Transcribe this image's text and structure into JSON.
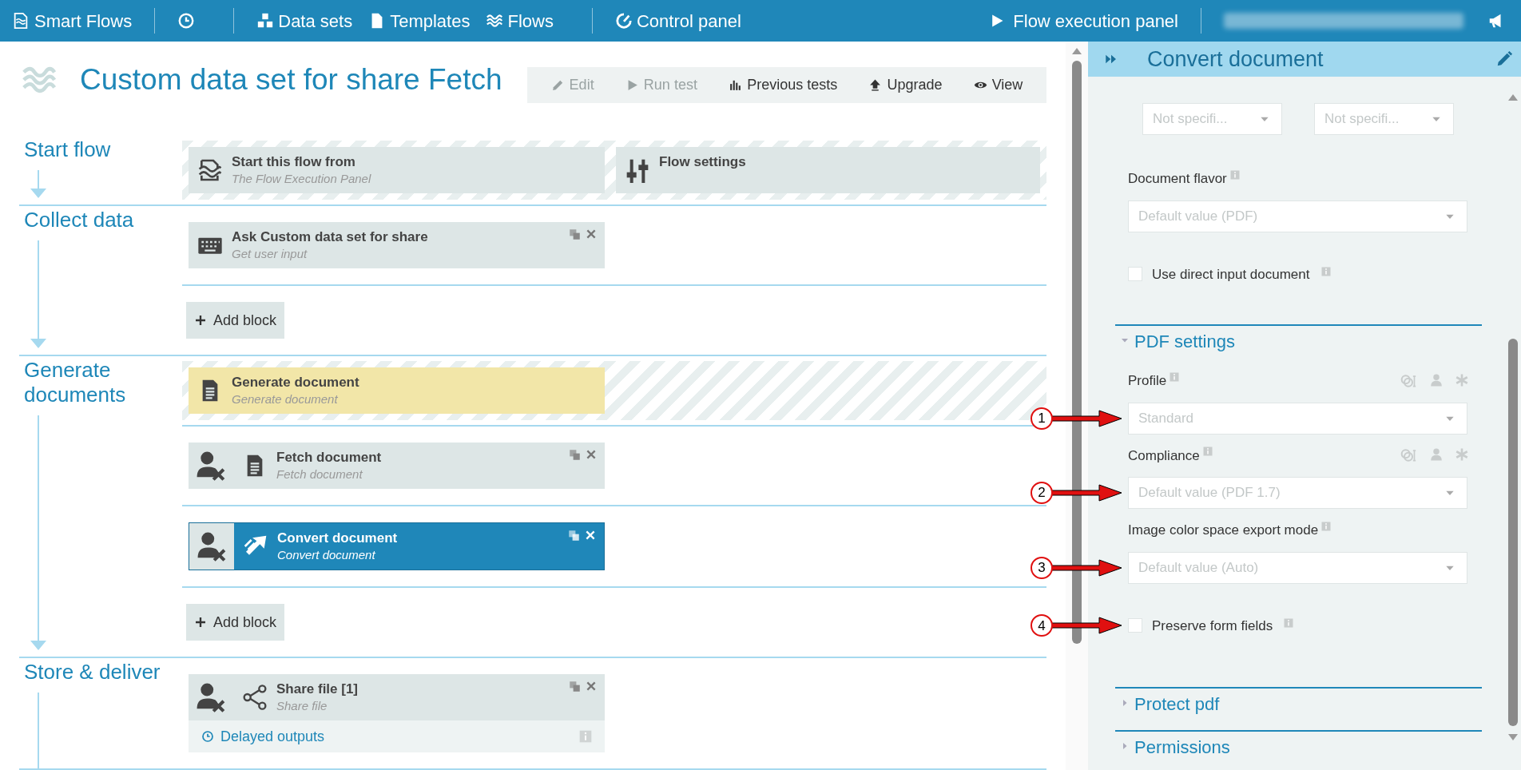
{
  "navbar": {
    "brand": "Smart Flows",
    "items": [
      {
        "kind": "history"
      },
      {
        "kind": "datasets",
        "label": "Data sets"
      },
      {
        "kind": "templates",
        "label": "Templates"
      },
      {
        "kind": "flows",
        "label": "Flows"
      },
      {
        "kind": "control",
        "label": "Control panel"
      }
    ],
    "right_label": "Flow execution panel"
  },
  "page": {
    "title": "Custom data set for share Fetch",
    "toolbar": [
      {
        "kind": "edit",
        "label": "Edit",
        "disabled": true
      },
      {
        "kind": "run",
        "label": "Run test",
        "disabled": true
      },
      {
        "kind": "tests",
        "label": "Previous tests",
        "disabled": false
      },
      {
        "kind": "upgrade",
        "label": "Upgrade",
        "disabled": false
      },
      {
        "kind": "view",
        "label": "View",
        "disabled": false
      }
    ]
  },
  "sections": [
    {
      "title": "Start flow",
      "arrow_head": true,
      "rows": [
        {
          "kind": "blocks",
          "hatched": true,
          "blocks": [
            {
              "kind": "start",
              "title": "Start this flow from",
              "subtitle": "The Flow Execution Panel",
              "unassigned": false,
              "actions": false,
              "selected": false,
              "highlighted": false
            },
            {
              "kind": "settings",
              "title": "Flow settings",
              "unassigned": false,
              "actions": false,
              "selected": false,
              "highlighted": false
            }
          ]
        }
      ]
    },
    {
      "title": "Collect data",
      "arrow_head": true,
      "rows": [
        {
          "kind": "blocks",
          "hatched": false,
          "blocks": [
            {
              "kind": "keyboard",
              "title": "Ask Custom data set for share",
              "subtitle": "Get user input",
              "unassigned": false,
              "actions": true,
              "selected": false,
              "highlighted": false
            }
          ]
        },
        {
          "kind": "add",
          "label": "Add block"
        }
      ]
    },
    {
      "title": "Generate documents",
      "arrow_head": true,
      "rows": [
        {
          "kind": "blocks",
          "hatched": true,
          "blocks": [
            {
              "kind": "document",
              "title": "Generate document",
              "subtitle": "Generate document",
              "unassigned": false,
              "actions": false,
              "selected": false,
              "highlighted": true
            }
          ]
        },
        {
          "kind": "blocks",
          "hatched": false,
          "blocks": [
            {
              "kind": "document",
              "title": "Fetch document",
              "subtitle": "Fetch document",
              "unassigned": true,
              "actions": true,
              "selected": false,
              "highlighted": false
            }
          ]
        },
        {
          "kind": "blocks",
          "hatched": false,
          "blocks": [
            {
              "kind": "convert",
              "title": "Convert document",
              "subtitle": "Convert document",
              "unassigned": true,
              "actions": true,
              "selected": true,
              "highlighted": false
            }
          ]
        },
        {
          "kind": "add",
          "label": "Add block"
        }
      ]
    },
    {
      "title": "Store & deliver",
      "arrow_head": false,
      "rows": [
        {
          "kind": "blocks",
          "hatched": false,
          "blocks": [
            {
              "kind": "share",
              "title": "Share file [1]",
              "subtitle": "Share file",
              "unassigned": true,
              "actions": true,
              "selected": false,
              "highlighted": false,
              "footer": "Delayed outputs"
            }
          ]
        }
      ]
    }
  ],
  "panel": {
    "title": "Convert document",
    "top_selects": [
      {
        "value": "Not specifi..."
      },
      {
        "value": "Not specifi..."
      }
    ],
    "fields": [
      {
        "kind": "select",
        "label": "Document flavor",
        "value": "Default value (PDF)",
        "binding_icons": false
      },
      {
        "kind": "checkbox",
        "label": "Use direct input document",
        "checked": false
      }
    ],
    "sections": [
      {
        "title": "PDF settings",
        "expanded": true,
        "fields": [
          {
            "kind": "select",
            "label": "Profile",
            "value": "Standard",
            "binding_icons": true,
            "callout": "1"
          },
          {
            "kind": "select",
            "label": "Compliance",
            "value": "Default value (PDF 1.7)",
            "binding_icons": true,
            "callout": "2"
          },
          {
            "kind": "select",
            "label": "Image color space export mode",
            "value": "Default value (Auto)",
            "binding_icons": false,
            "callout": "3"
          },
          {
            "kind": "checkbox",
            "label": "Preserve form fields",
            "checked": false,
            "callout": "4"
          }
        ]
      },
      {
        "title": "Protect pdf",
        "expanded": false
      },
      {
        "title": "Permissions",
        "expanded": false
      }
    ]
  }
}
